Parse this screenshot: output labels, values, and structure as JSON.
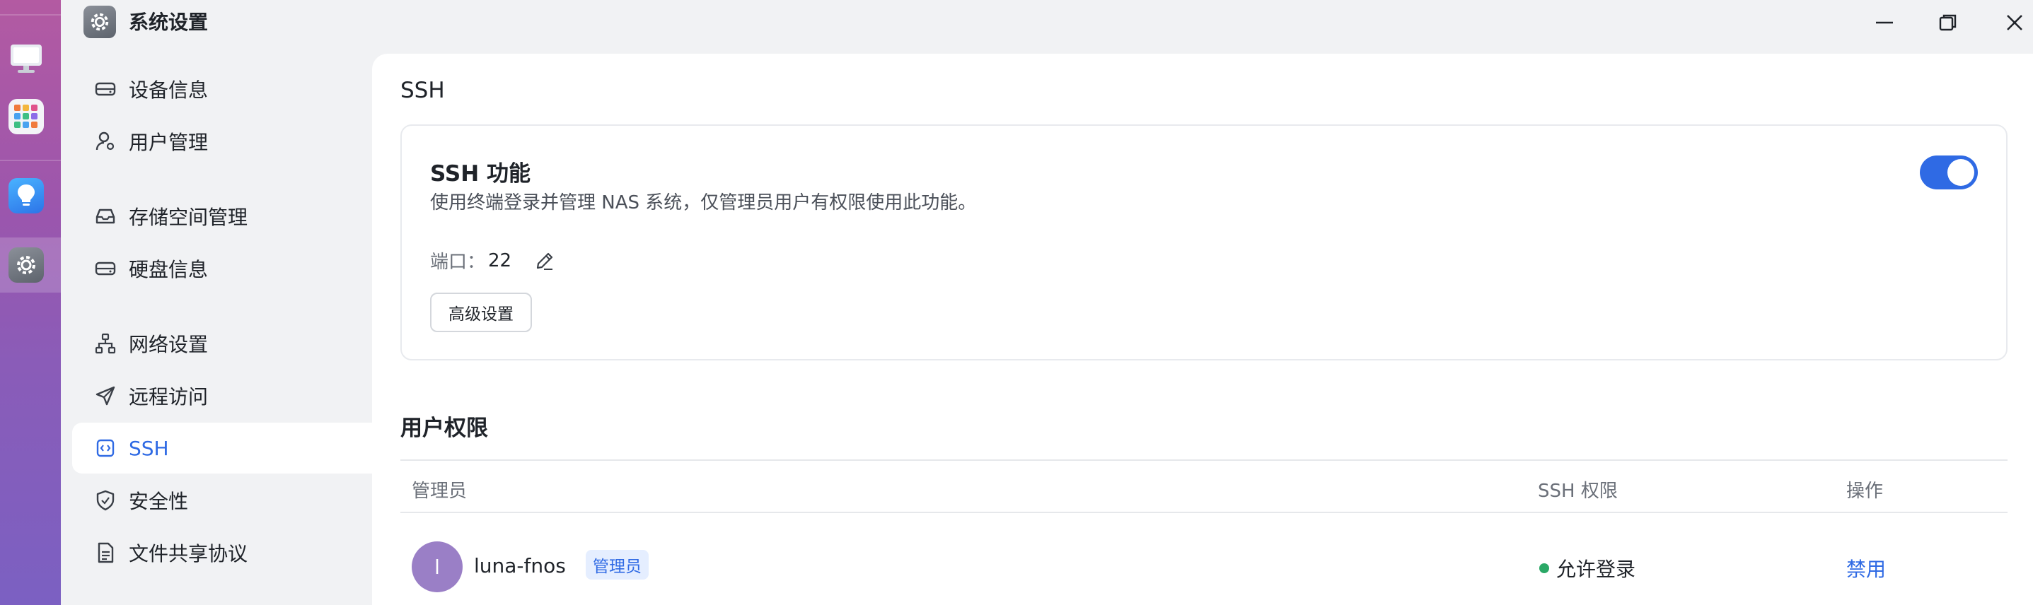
{
  "window": {
    "title": "系统设置"
  },
  "dock": {
    "items": [
      {
        "icon": "desktop-icon"
      },
      {
        "icon": "app-center-icon"
      },
      {
        "icon": "lightbulb-icon"
      },
      {
        "icon": "settings-icon",
        "active": true
      }
    ]
  },
  "sidebar": {
    "items": [
      {
        "label": "设备信息",
        "icon": "device-info-icon"
      },
      {
        "label": "用户管理",
        "icon": "user-manage-icon"
      },
      {
        "label": "存储空间管理",
        "icon": "storage-icon"
      },
      {
        "label": "硬盘信息",
        "icon": "disk-icon"
      },
      {
        "label": "网络设置",
        "icon": "network-icon"
      },
      {
        "label": "远程访问",
        "icon": "remote-access-icon"
      },
      {
        "label": "SSH",
        "icon": "ssh-icon",
        "active": true
      },
      {
        "label": "安全性",
        "icon": "security-shield-icon"
      },
      {
        "label": "文件共享协议",
        "icon": "file-share-icon"
      }
    ]
  },
  "main": {
    "section_title": "SSH",
    "ssh_card": {
      "title": "SSH 功能",
      "description": "使用终端登录并管理 NAS 系统，仅管理员用户有权限使用此功能。",
      "port_label": "端口：",
      "port_value": "22",
      "advanced_button": "高级设置",
      "enabled": true
    },
    "permissions": {
      "title": "用户权限",
      "columns": [
        "管理员",
        "SSH 权限",
        "操作"
      ],
      "rows": [
        {
          "avatar_letter": "l",
          "username": "luna-fnos",
          "badge": "管理员",
          "permission": "允许登录",
          "action": "禁用"
        }
      ]
    }
  },
  "colors": {
    "accent": "#2f6ae4",
    "status_allowed": "#2aa866",
    "avatar": "#9a7fc6"
  }
}
